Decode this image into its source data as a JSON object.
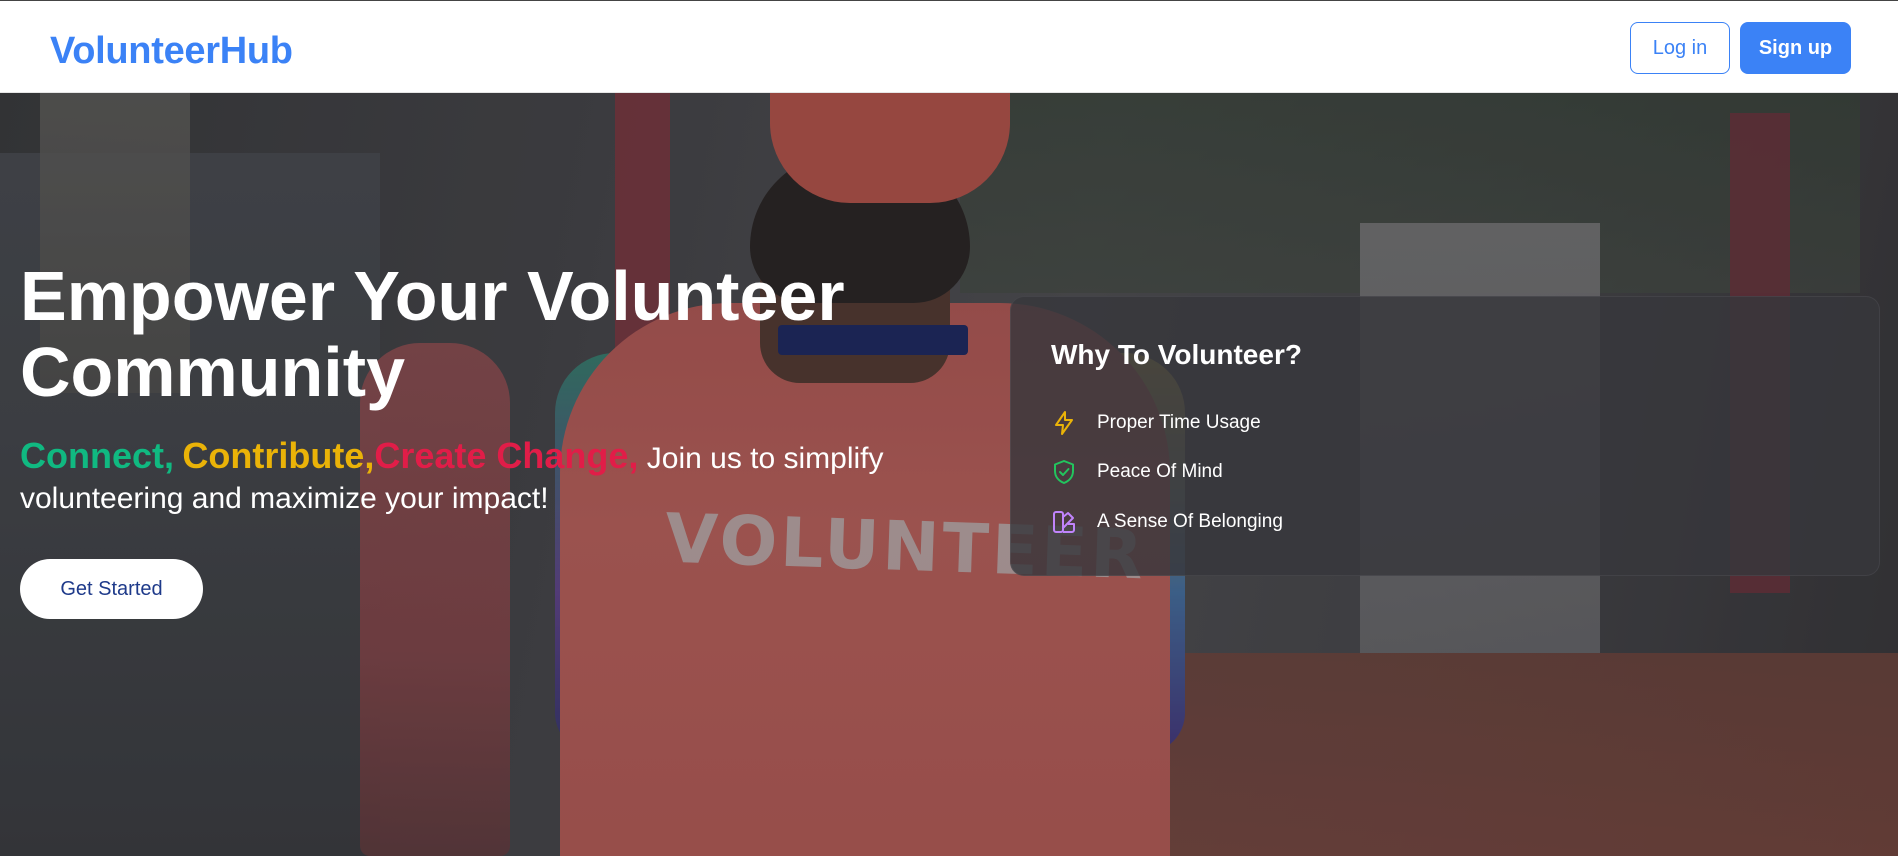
{
  "header": {
    "brand": "VolunteerHub",
    "login_label": "Log in",
    "signup_label": "Sign up"
  },
  "hero": {
    "title": "Empower Your Volunteer Community",
    "keywords": [
      {
        "text": "Connect,",
        "color": "#10b981"
      },
      {
        "text": "Contribute,",
        "color": "#eab308"
      },
      {
        "text": "Create Change,",
        "color": "#e11d48"
      }
    ],
    "subtitle": "Join us to simplify volunteering and maximize your impact!",
    "cta_label": "Get Started",
    "background_shirt_text": "VOLUNTEER"
  },
  "why_card": {
    "title": "Why To Volunteer?",
    "items": [
      {
        "label": "Proper Time Usage",
        "icon": "lightning-icon",
        "color": "#eab308"
      },
      {
        "label": "Peace Of Mind",
        "icon": "shield-check-icon",
        "color": "#22c55e"
      },
      {
        "label": "A Sense Of Belonging",
        "icon": "swatch-icon",
        "color": "#c084fc"
      }
    ]
  },
  "colors": {
    "brand": "#3b82f6",
    "cta_text": "#1e3a8a"
  }
}
